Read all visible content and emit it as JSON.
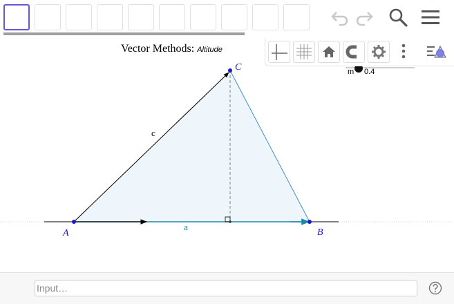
{
  "toolbar": {
    "tool_slot_count": 10,
    "undo_icon": "undo-icon",
    "redo_icon": "redo-icon",
    "search_icon": "search-icon",
    "menu_icon": "hamburger-menu-icon"
  },
  "style_bar": {
    "buttons": [
      "axes-icon",
      "grid-icon",
      "home-icon",
      "magnet-icon",
      "gear-icon",
      "more-vertical-icon",
      "style-bar-toggle-icon"
    ]
  },
  "title": {
    "main": "Vector Methods:",
    "sub": "Altitude"
  },
  "slider": {
    "label": "m",
    "value": "0.4"
  },
  "figure": {
    "points": [
      "A",
      "B",
      "C"
    ],
    "labels": [
      "c",
      "a"
    ]
  },
  "input_bar": {
    "placeholder": "Input…"
  },
  "colors": {
    "accent": "#6557d2",
    "point_blue": "#1a1acc",
    "triangle_fill": "#eef6fb",
    "altitude": "#808080"
  }
}
